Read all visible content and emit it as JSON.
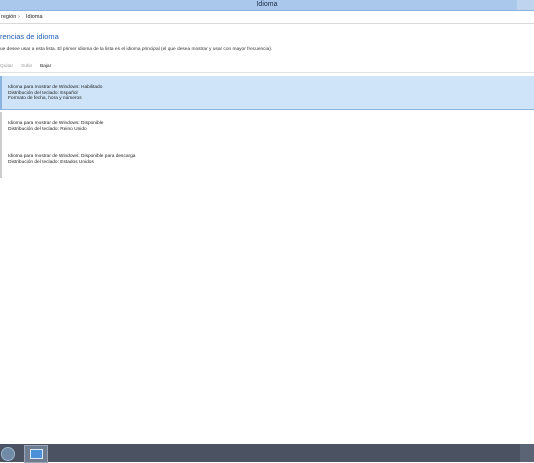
{
  "window": {
    "title": "Idioma"
  },
  "address": {
    "crumbs": [
      "región",
      "Idioma"
    ],
    "separator": "›"
  },
  "page": {
    "heading": "rencias de idioma",
    "description": "ue desee usar a esta lista. El primer idioma de la lista es el idioma principal (el que desea mostrar y usar con mayor frecuencia)."
  },
  "toolbar": {
    "remove_label": "Quitar",
    "up_label": "Subir",
    "down_label": "Bajar"
  },
  "languages": [
    {
      "lines": [
        "Idioma para mostrar de Windows: Habilitado",
        "Distribución del teclado: Español",
        "Formato de fecha, hora y números"
      ]
    },
    {
      "lines": [
        "Idioma para mostrar de Windows: Disponible",
        "Distribución del teclado: Reino Unido"
      ]
    },
    {
      "lines": [
        "Idioma para mostrar de Windows: Disponible para descarga",
        "Distribución del teclado: Estados Unidos"
      ]
    }
  ],
  "colors": {
    "heading": "#1e5fb5",
    "selected_bg": "#cfe4f8",
    "titlebar": "#a9c8ec",
    "taskbar": "#4b5362"
  },
  "icons": {
    "start": "windows-start-icon",
    "taskbar_app": "control-panel-icon"
  }
}
